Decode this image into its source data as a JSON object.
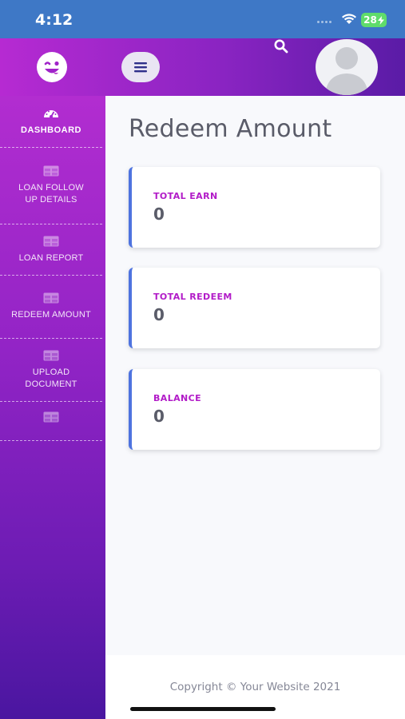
{
  "status_bar": {
    "time": "4:12",
    "battery": "28"
  },
  "header": {
    "menu_icon": "hamburger-icon",
    "search_icon": "search-icon",
    "logo_icon": "wink-face-icon",
    "avatar_icon": "user-avatar-icon"
  },
  "sidebar": {
    "items": [
      {
        "label": "DASHBOARD",
        "icon": "speedometer-icon"
      },
      {
        "label": "LOAN FOLLOW UP DETAILS",
        "icon": "table-icon"
      },
      {
        "label": "LOAN REPORT",
        "icon": "table-icon"
      },
      {
        "label": "REDEEM AMOUNT",
        "icon": "table-icon"
      },
      {
        "label": "UPLOAD DOCUMENT",
        "icon": "table-icon"
      },
      {
        "label": "",
        "icon": "table-icon"
      }
    ]
  },
  "main": {
    "title": "Redeem Amount",
    "cards": [
      {
        "label": "TOTAL EARN",
        "value": "0"
      },
      {
        "label": "TOTAL REDEEM",
        "value": "0"
      },
      {
        "label": "BALANCE",
        "value": "0"
      }
    ]
  },
  "footer": {
    "copyright": "Copyright © Your Website 2021"
  },
  "colors": {
    "accent": "#4e73df",
    "brand": "#b21bc8",
    "statusbar": "#3e78c6"
  }
}
